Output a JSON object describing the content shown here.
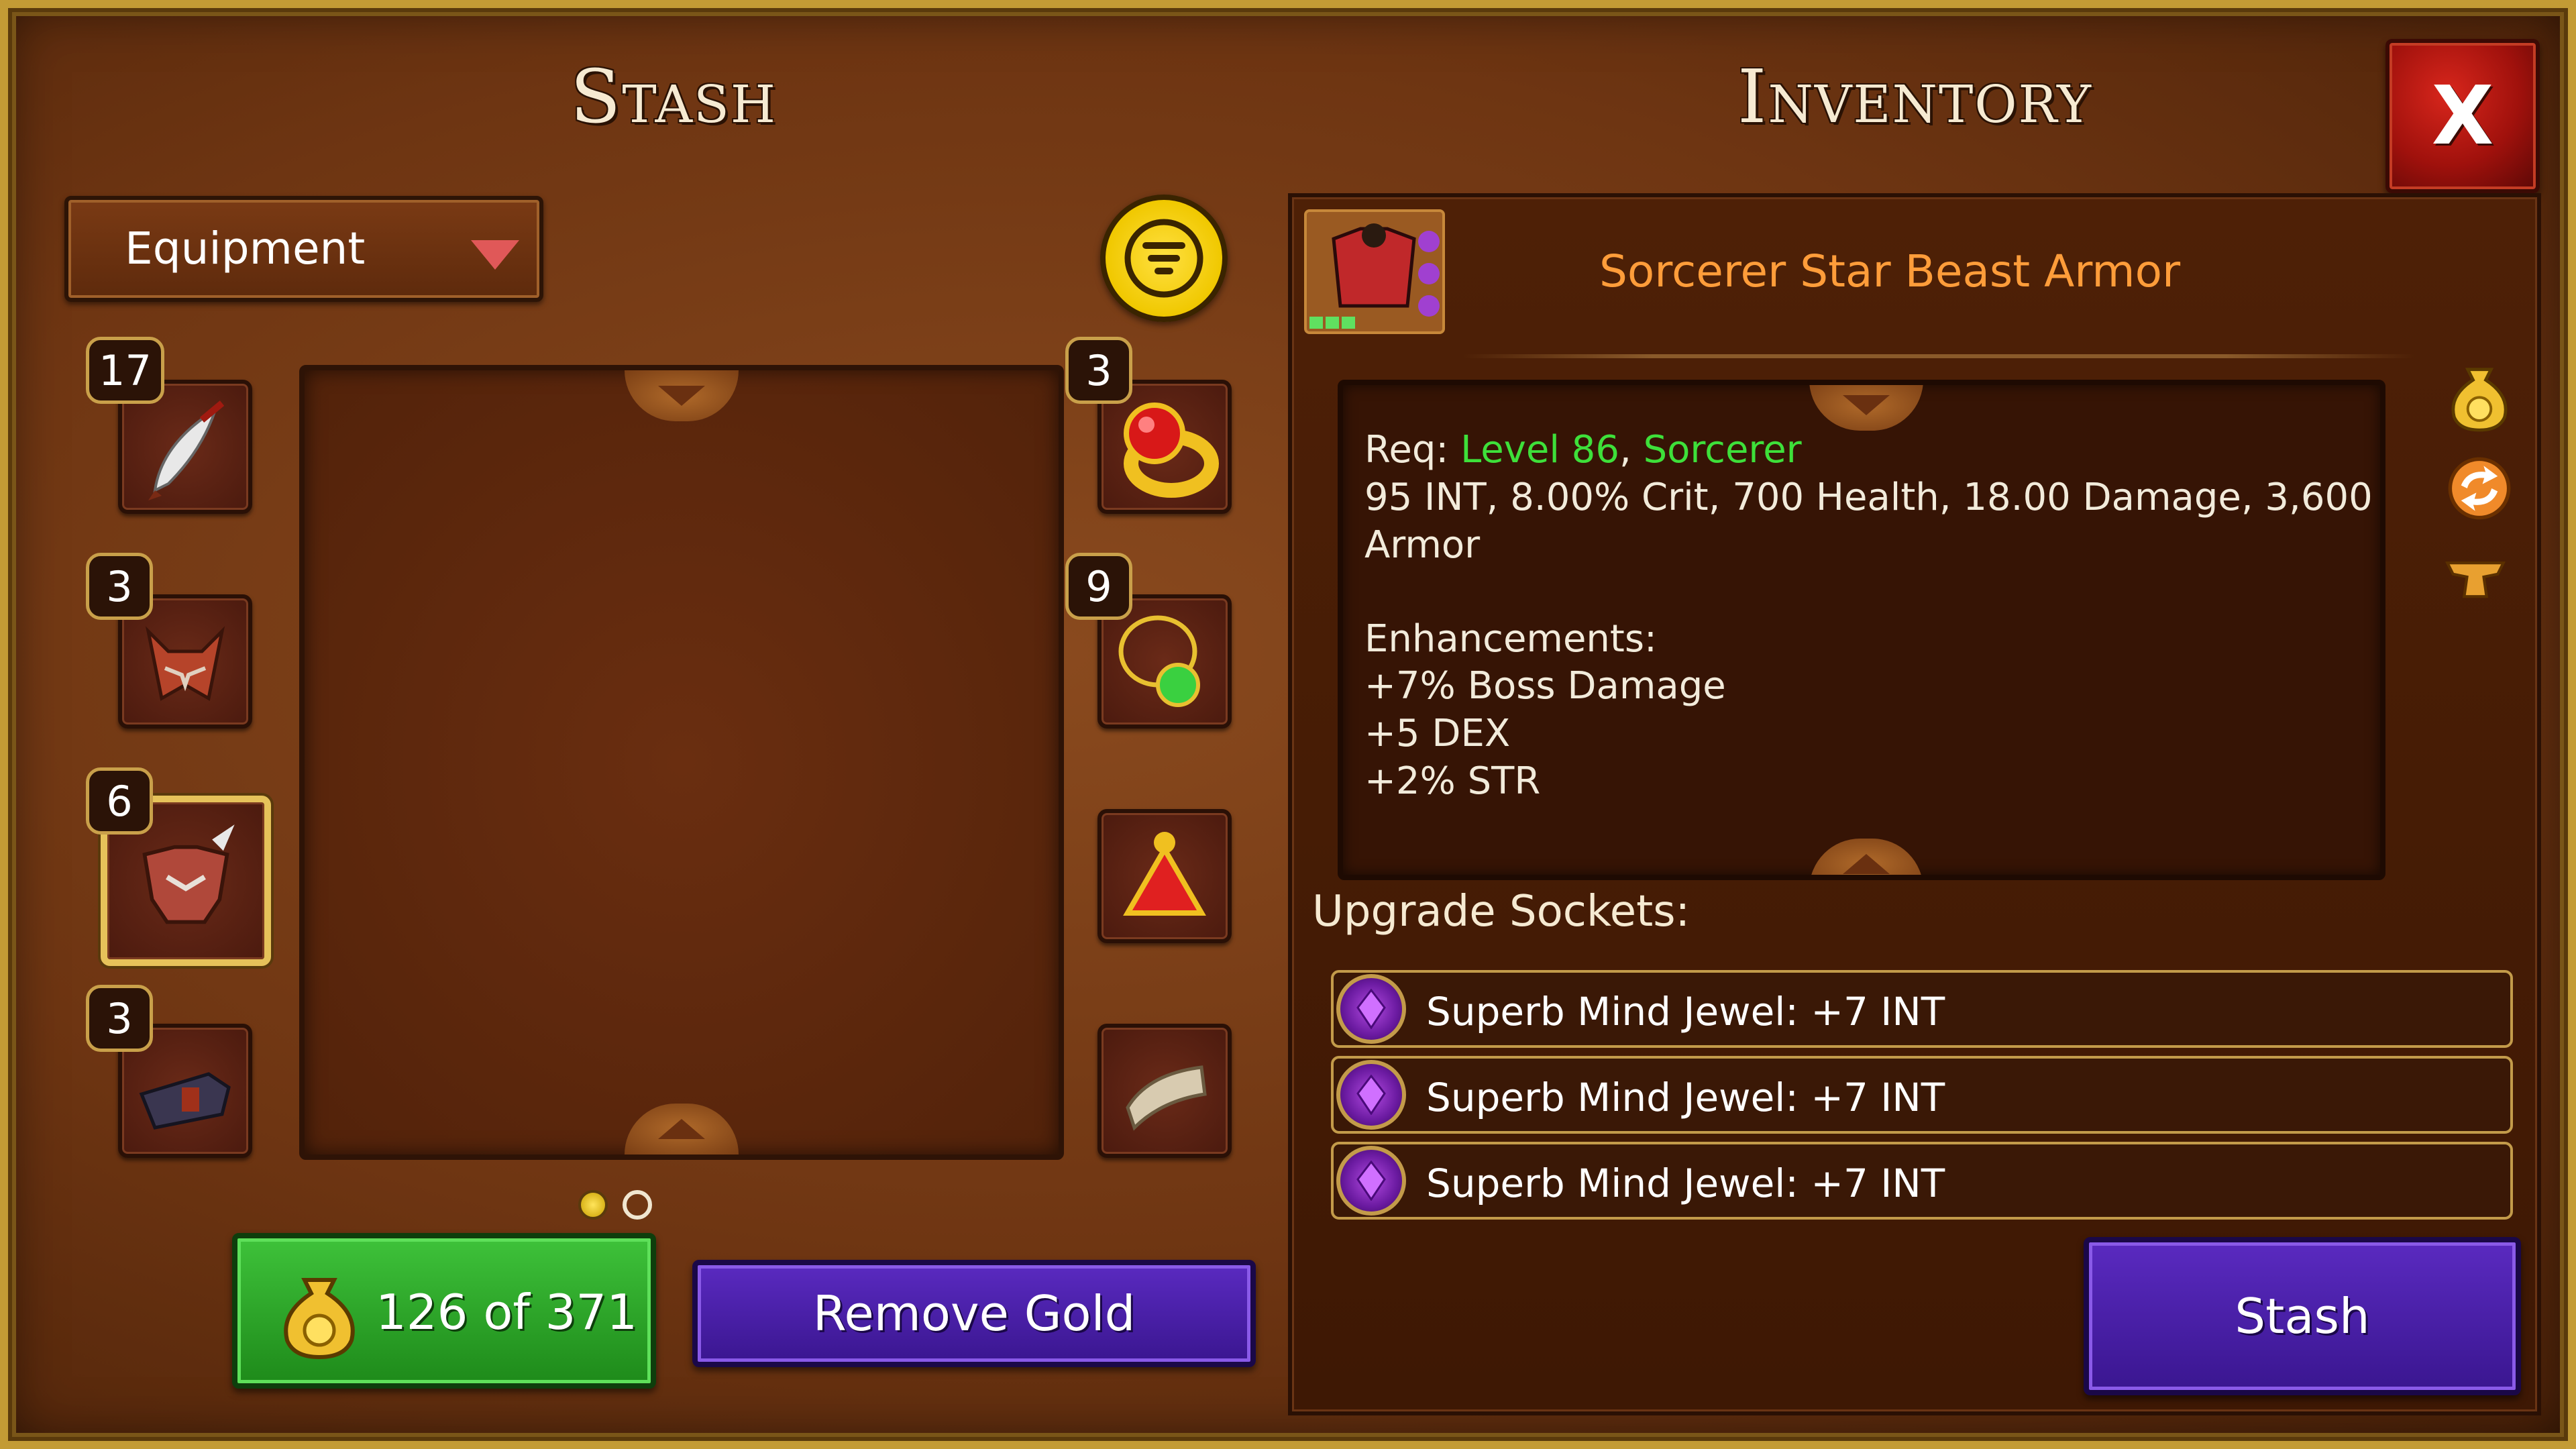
{
  "stash": {
    "title": "Stash",
    "dropdown_label": "Equipment",
    "slots_left": [
      {
        "count": "17",
        "item": "dagger-icon"
      },
      {
        "count": "3",
        "item": "horned-helmet-icon"
      },
      {
        "count": "6",
        "item": "chest-armor-icon",
        "selected": true
      },
      {
        "count": "3",
        "item": "boots-icon"
      }
    ],
    "slots_right": [
      {
        "count": "3",
        "item": "ruby-ring-icon"
      },
      {
        "count": "9",
        "item": "emerald-amulet-icon"
      },
      {
        "count": "",
        "item": "red-crystal-icon"
      },
      {
        "count": "",
        "item": "scroll-icon"
      }
    ],
    "gold_label": "126 of 371",
    "remove_gold_label": "Remove Gold"
  },
  "inventory": {
    "title": "Inventory",
    "close_label": "X",
    "item": {
      "close_label": "X",
      "name": "Sorcerer Star Beast Armor",
      "req_prefix": "Req: ",
      "req_level": "Level 86",
      "req_sep": ", ",
      "req_class": "Sorcerer",
      "stats_line1": "95 INT, 8.00% Crit, 700 Health, 18.00 Damage, 3,600",
      "stats_line2": "Armor",
      "enhancements_label": "Enhancements:",
      "enhancements": [
        "+7% Boss Damage",
        "+5 DEX",
        "+2% STR"
      ]
    },
    "sockets_label": "Upgrade Sockets:",
    "sockets": [
      "Superb Mind Jewel: +7 INT",
      "Superb Mind Jewel: +7 INT",
      "Superb Mind Jewel: +7 INT"
    ],
    "stash_button_label": "Stash"
  },
  "colors": {
    "item_name": "#ff9d3a",
    "requirement_met": "#3ee03a",
    "enhancement": "#6fe06a",
    "gold_button": "#2aa426",
    "action_button": "#4a20a8",
    "close_button": "#b8140e"
  }
}
